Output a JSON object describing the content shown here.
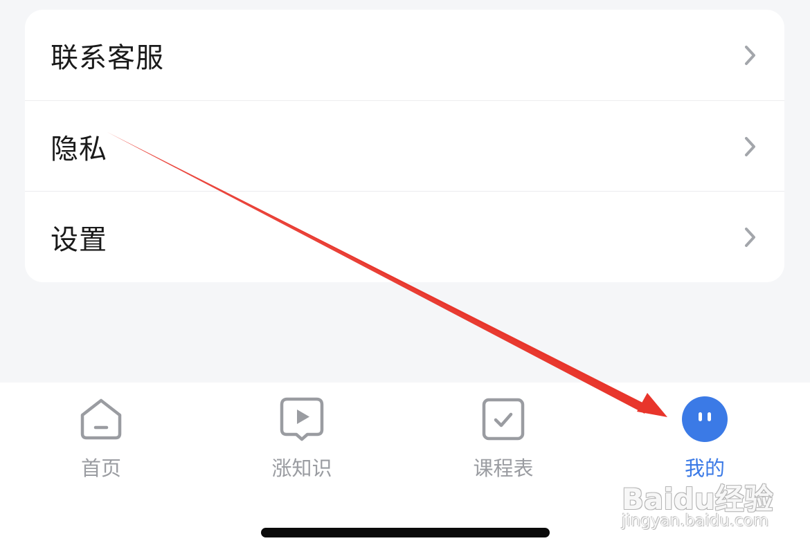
{
  "menu": {
    "items": [
      {
        "label": "联系客服"
      },
      {
        "label": "隐私"
      },
      {
        "label": "设置"
      }
    ],
    "chevron_icon": "chevron-right-icon"
  },
  "tabbar": {
    "tabs": [
      {
        "label": "首页",
        "icon": "home-icon",
        "active": false
      },
      {
        "label": "涨知识",
        "icon": "play-bubble-icon",
        "active": false
      },
      {
        "label": "课程表",
        "icon": "checkbox-icon",
        "active": false
      },
      {
        "label": "我的",
        "icon": "face-avatar-icon",
        "active": true
      }
    ],
    "inactive_color": "#9a9ca1",
    "active_color": "#3b7ae6"
  },
  "annotation": {
    "arrow_color": "#e8352b"
  },
  "watermark": {
    "main": "Baidu经验",
    "sub": "jingyan.baidu.com"
  }
}
